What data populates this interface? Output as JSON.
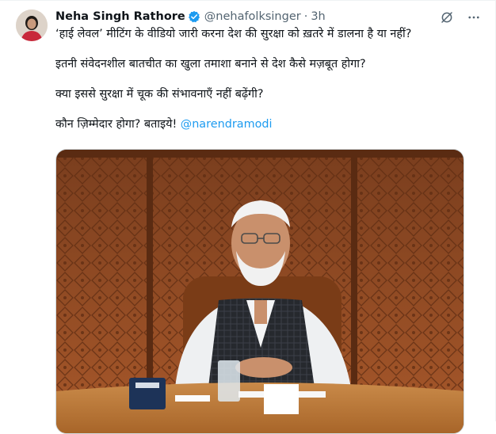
{
  "user": {
    "display_name": "Neha Singh Rathore",
    "handle": "@nehafolksinger",
    "separator": "·",
    "time": "3h"
  },
  "icons": {
    "verified": "verified-badge-icon",
    "grok": "grok-icon",
    "more": "more-dots-icon"
  },
  "colors": {
    "accent": "#1d9bf0",
    "muted": "#536471",
    "text": "#0f1419"
  },
  "tweet": {
    "lines": [
      "‘हाई लेवल’ मीटिंग के वीडियो जारी करना देश की सुरक्षा को ख़तरे में डालना है या नहीं?",
      "इतनी संवेदनशील बातचीत का खुला तमाशा बनाने से देश कैसे मज़बूत होगा?",
      "क्या इससे सुरक्षा में चूक की संभावनाएँ नहीं बढ़ेंगी?"
    ],
    "last_line_text": "कौन ज़िम्मेदार होगा? बताइये! ",
    "mention": "@narendramodi"
  }
}
